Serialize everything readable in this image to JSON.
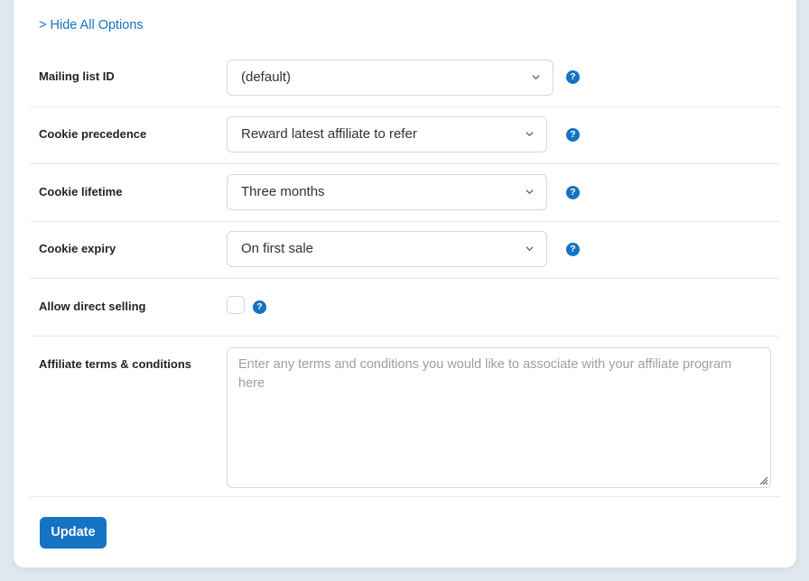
{
  "toggle_link": "> Hide All Options",
  "fields": {
    "mailing_list": {
      "label": "Mailing list ID",
      "value": "(default)"
    },
    "cookie_precedence": {
      "label": "Cookie precedence",
      "value": "Reward latest affiliate to refer"
    },
    "cookie_lifetime": {
      "label": "Cookie lifetime",
      "value": "Three months"
    },
    "cookie_expiry": {
      "label": "Cookie expiry",
      "value": "On first sale"
    },
    "direct_selling": {
      "label": "Allow direct selling",
      "checked": false
    },
    "terms": {
      "label": "Affiliate terms & conditions",
      "placeholder": "Enter any terms and conditions you would like to associate with your affiliate program here"
    }
  },
  "help_glyph": "?",
  "update_label": "Update",
  "icons": {
    "select_arrow": "chevron-down-icon",
    "help": "help-icon",
    "resize": "resize-grip-icon"
  },
  "colors": {
    "accent": "#1473c2",
    "background": "#dfe8ef",
    "card": "#ffffff"
  }
}
